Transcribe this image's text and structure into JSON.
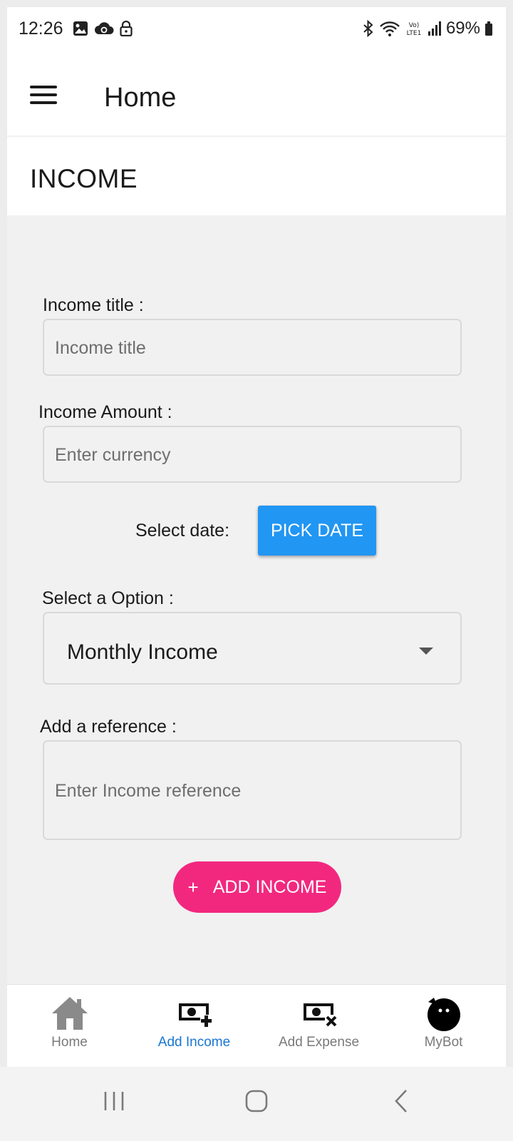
{
  "status_bar": {
    "time": "12:26",
    "battery": "69%",
    "left_icons": [
      "image-icon",
      "cloud-sync-icon",
      "lock-icon"
    ],
    "right_icons": [
      "bluetooth-icon",
      "wifi-icon",
      "volte-icon",
      "signal-icon",
      "battery-icon"
    ],
    "volte_text": "VoLTE1"
  },
  "app_bar": {
    "title": "Home",
    "menu_icon": "hamburger-menu-icon"
  },
  "section": {
    "title": "INCOME"
  },
  "form": {
    "title_label": "Income title :",
    "title_placeholder": "Income title",
    "amount_label": "Income Amount :",
    "amount_placeholder": "Enter currency",
    "date_label": "Select date:",
    "pick_date_label": "PICK DATE",
    "option_label": "Select a Option :",
    "option_value": "Monthly Income",
    "reference_label": "Add a reference :",
    "reference_placeholder": "Enter Income reference",
    "submit_label": "ADD INCOME",
    "submit_icon": "plus-icon"
  },
  "bottom_nav": {
    "items": [
      {
        "label": "Home",
        "icon": "home-icon",
        "active": false
      },
      {
        "label": "Add Income",
        "icon": "money-add-icon",
        "active": true
      },
      {
        "label": "Add Expense",
        "icon": "money-remove-icon",
        "active": false
      },
      {
        "label": "MyBot",
        "icon": "bot-icon",
        "active": false
      }
    ]
  },
  "colors": {
    "accent_blue": "#2196f3",
    "active_nav": "#1976d2",
    "pink_button": "#f2287f",
    "background": "#f1f1f1"
  }
}
